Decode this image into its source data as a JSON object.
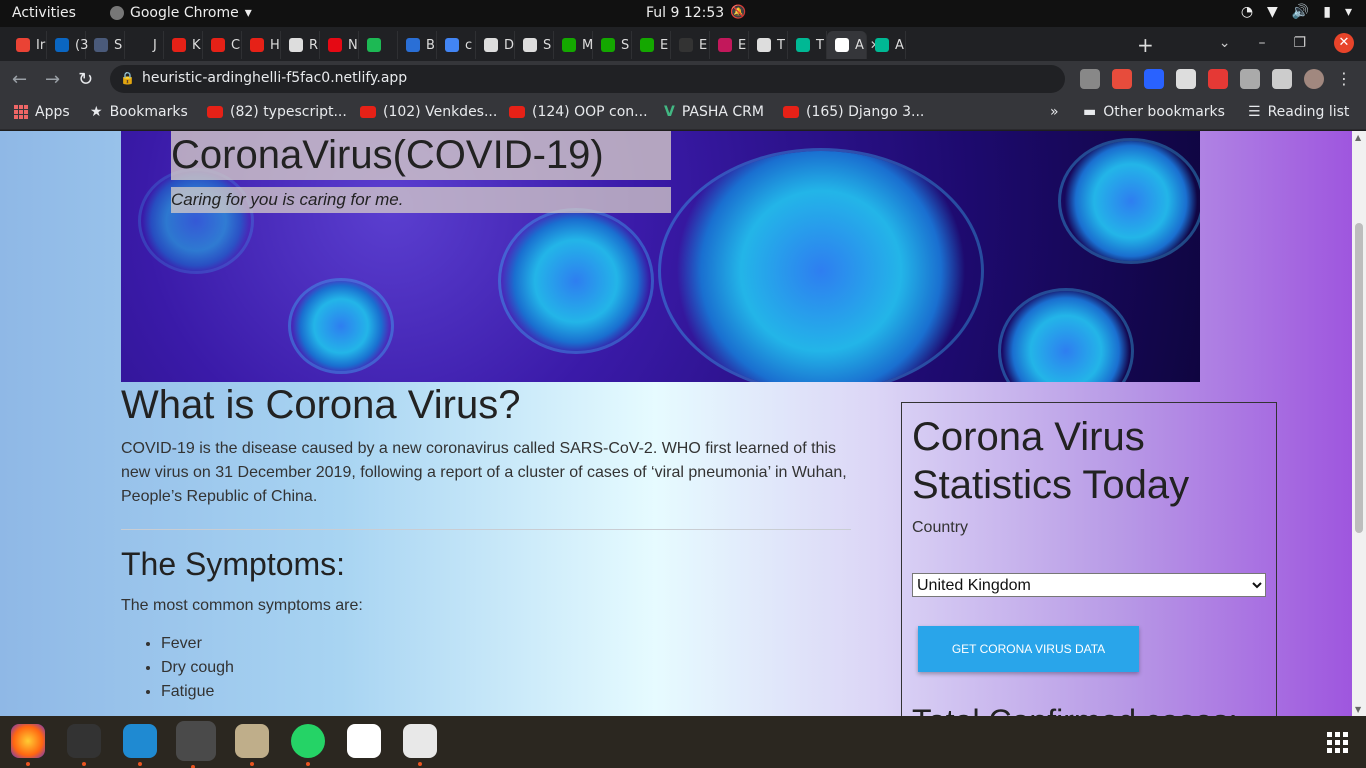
{
  "topbar": {
    "activities": "Activities",
    "app_name": "Google Chrome",
    "clock": "Ful 9  12:53"
  },
  "tabs": [
    {
      "label": "Ir",
      "color": "#ea4335"
    },
    {
      "label": "(3",
      "color": "#0a66c2"
    },
    {
      "label": "S",
      "color": "#4a5a7a"
    },
    {
      "label": "J",
      "color": "#202124"
    },
    {
      "label": "K",
      "color": "#e62117"
    },
    {
      "label": "C",
      "color": "#e62117"
    },
    {
      "label": "H",
      "color": "#e62117"
    },
    {
      "label": "R",
      "color": "#dddddd"
    },
    {
      "label": "N",
      "color": "#e50914"
    },
    {
      "label": "",
      "color": "#1db954"
    },
    {
      "label": "B",
      "color": "#2a6fd6"
    },
    {
      "label": "c",
      "color": "#4285f4"
    },
    {
      "label": "D",
      "color": "#dddddd"
    },
    {
      "label": "S",
      "color": "#dddddd"
    },
    {
      "label": "M",
      "color": "#14a800"
    },
    {
      "label": "S",
      "color": "#14a800"
    },
    {
      "label": "E",
      "color": "#14a800"
    },
    {
      "label": "E",
      "color": "#333333"
    },
    {
      "label": "E",
      "color": "#c2185b"
    },
    {
      "label": "T",
      "color": "#dddddd"
    },
    {
      "label": "T",
      "color": "#00b894"
    },
    {
      "label": "A",
      "color": "#ffffff"
    },
    {
      "label": "A",
      "color": "#00b894"
    }
  ],
  "toolbar": {
    "url": "heuristic-ardinghelli-f5fac0.netlify.app"
  },
  "bookmarks": {
    "apps": "Apps",
    "bookmarks": "Bookmarks",
    "items": [
      "(82) typescript...",
      "(102) Venkdes...",
      "(124) OOP con...",
      "PASHA CRM",
      "(165) Django 3..."
    ],
    "more": "»",
    "other": "Other bookmarks",
    "reading": "Reading list"
  },
  "page": {
    "hero_title": "CoronaVirus(COVID-19)",
    "hero_subtitle": "Caring for you is caring for me.",
    "what_heading": "What is Corona Virus?",
    "what_text": "COVID-19 is the disease caused by a new coronavirus called SARS-CoV-2. WHO first learned of this new virus on 31 December 2019, following a report of a cluster of cases of ‘viral pneumonia’ in Wuhan, People’s Republic of China.",
    "symptoms_heading": "The Symptoms:",
    "symptoms_lead": "The most common symptoms are:",
    "symptoms": [
      "Fever",
      "Dry cough",
      "Fatigue"
    ],
    "stats_heading": "Corona Virus Statistics Today",
    "country_label": "Country",
    "country_selected": "United Kingdom",
    "get_button": "GET CORONA VIRUS DATA",
    "total_label": "Total Confirmed cases:"
  },
  "colors": {
    "accent_button": "#29a5ea",
    "gradient_left": "#8fb8e6",
    "gradient_right": "#9d52de"
  }
}
